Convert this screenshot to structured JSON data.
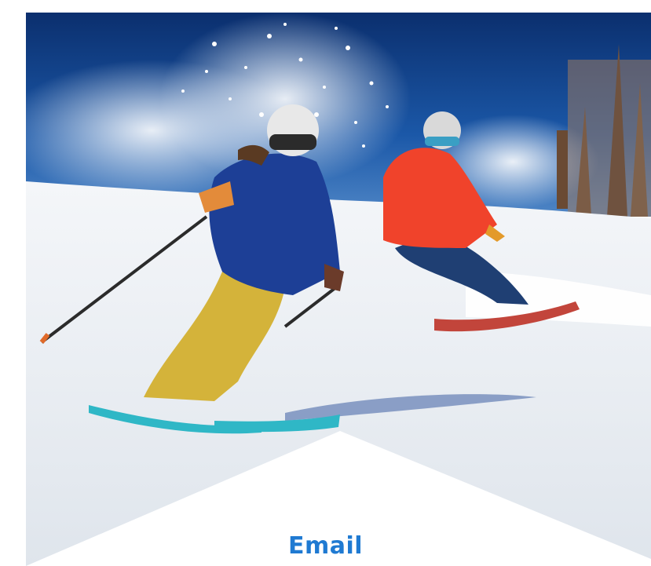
{
  "card": {
    "label": "Email",
    "label_color": "#1f7ad2",
    "image": {
      "subject": "skier-and-snowboarder-photo",
      "sky_color": "#0d3f86",
      "snow_color": "#eef2f6",
      "skier_jacket_color": "#1d3f96",
      "skier_pants_color": "#d4b33a",
      "snowboarder_jacket_color": "#f0432b",
      "ski_color": "#2fb7c6"
    }
  }
}
